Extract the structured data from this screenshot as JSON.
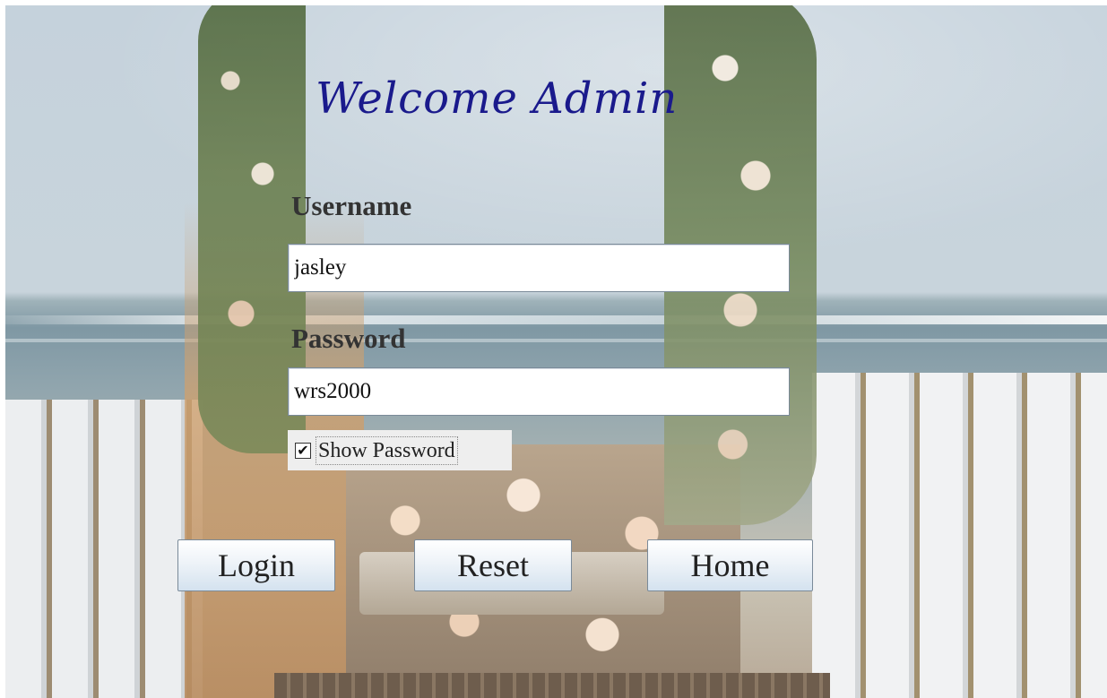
{
  "title": "Welcome Admin",
  "username": {
    "label": "Username",
    "value": "jasley"
  },
  "password": {
    "label": "Password",
    "value": "wrs2000"
  },
  "show_password": {
    "label": "Show Password",
    "checked": true,
    "check_glyph": "✔"
  },
  "buttons": {
    "login": "Login",
    "reset": "Reset",
    "home": "Home"
  },
  "colors": {
    "title": "#1a1a8c",
    "label": "#333333"
  }
}
